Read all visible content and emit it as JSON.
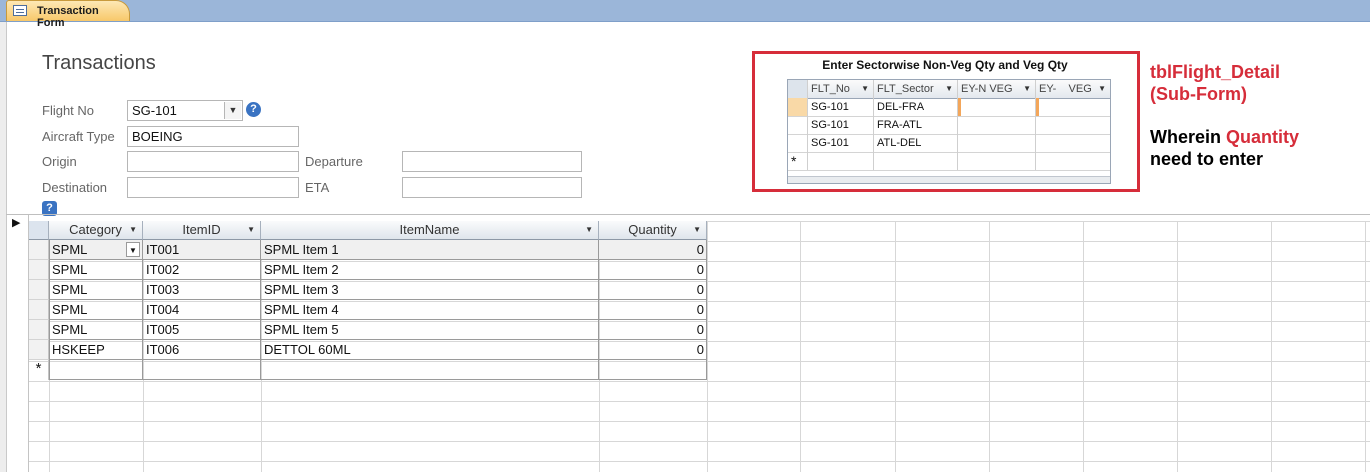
{
  "tab": {
    "label": "Transaction Form"
  },
  "form": {
    "title": "Transactions",
    "flight_no_label": "Flight No",
    "flight_no_value": "SG-101",
    "aircraft_type_label": "Aircraft Type",
    "aircraft_type_value": "BOEING",
    "origin_label": "Origin",
    "origin_value": "",
    "departure_label": "Departure",
    "departure_value": "",
    "destination_label": "Destination",
    "destination_value": "",
    "eta_label": "ETA",
    "eta_value": ""
  },
  "subform": {
    "title": "Enter Sectorwise Non-Veg Qty and Veg Qty",
    "columns": [
      "FLT_No",
      "FLT_Sector",
      "EY-N VEG",
      "EY-    VEG"
    ],
    "rows": [
      [
        "SG-101",
        "DEL-FRA",
        "",
        ""
      ],
      [
        "SG-101",
        "FRA-ATL",
        "",
        ""
      ],
      [
        "SG-101",
        "ATL-DEL",
        "",
        ""
      ]
    ],
    "new_row_marker": "*"
  },
  "annotation": {
    "line1": "tblFlight_Detail",
    "line2": "(Sub-Form)",
    "line3_prefix": "Wherein ",
    "line3_highlight": "Quantity",
    "line4": "need to enter"
  },
  "grid": {
    "columns": [
      "Category",
      "ItemID",
      "ItemName",
      "Quantity"
    ],
    "rows": [
      [
        "SPML",
        "IT001",
        "SPML Item 1",
        "0"
      ],
      [
        "SPML",
        "IT002",
        "SPML Item 2",
        "0"
      ],
      [
        "SPML",
        "IT003",
        "SPML Item 3",
        "0"
      ],
      [
        "SPML",
        "IT004",
        "SPML Item 4",
        "0"
      ],
      [
        "SPML",
        "IT005",
        "SPML Item 5",
        "0"
      ],
      [
        "HSKEEP",
        "IT006",
        "DETTOL 60ML",
        "0"
      ]
    ],
    "new_row_marker": "*",
    "current_record_marker": "▶"
  },
  "colors": {
    "annotation_red": "#d62d3a",
    "accent_blue": "#3a73c2"
  }
}
